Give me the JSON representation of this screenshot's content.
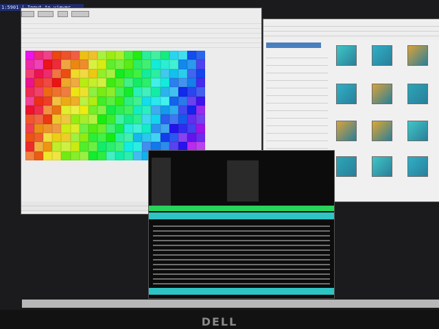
{
  "window": {
    "title": "1:5901 | Input to viewer"
  },
  "brand": {
    "logo": "DELL"
  },
  "colors": {
    "accent": "#1f2c6e",
    "term_green": "#27d35a",
    "term_cyan": "#2ec4c4"
  },
  "icons": {
    "close": "close-icon"
  }
}
